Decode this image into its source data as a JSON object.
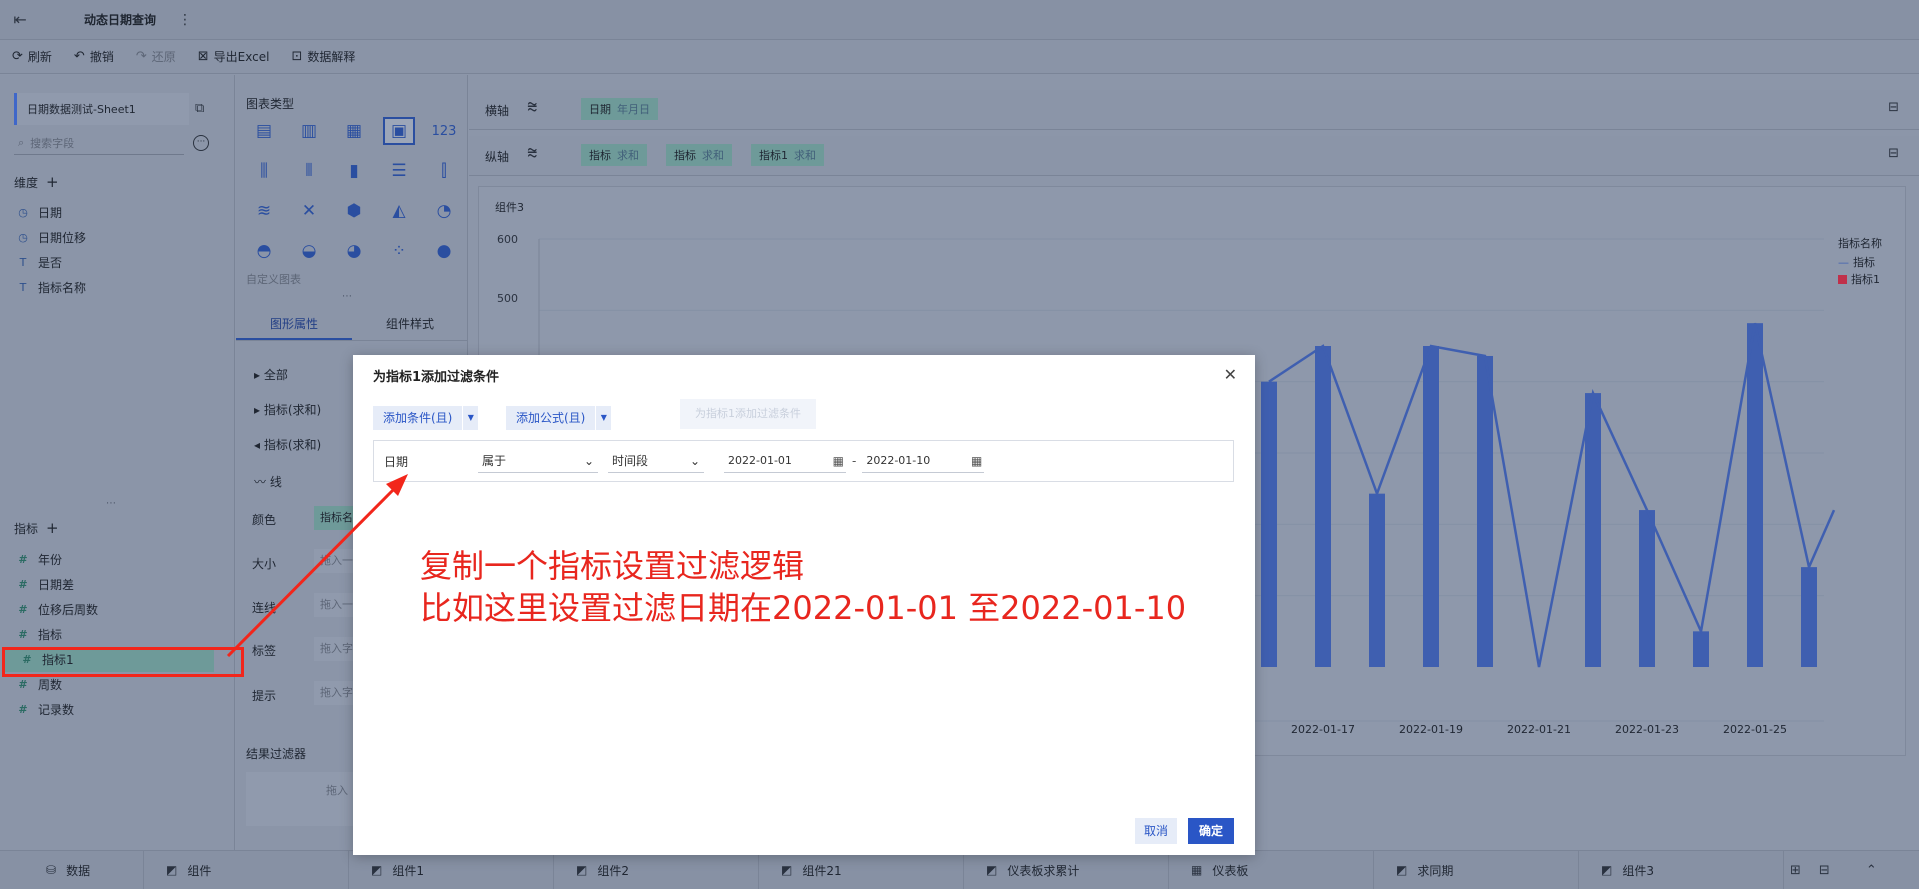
{
  "app": {
    "title": "动态日期查询",
    "back_icon": "back-icon",
    "more_icon": "more-icon"
  },
  "toolbar": {
    "refresh": "刷新",
    "undo": "撤销",
    "redo": "还原",
    "export": "导出Excel",
    "explain": "数据解释"
  },
  "left_panel": {
    "dataset": "日期数据测试-Sheet1",
    "search_placeholder": "搜索字段",
    "dimension_title": "维度",
    "dimensions": [
      {
        "label": "日期",
        "icon": "clock-icon"
      },
      {
        "label": "日期位移",
        "icon": "clock-icon"
      },
      {
        "label": "是否",
        "icon": "text-icon"
      },
      {
        "label": "指标名称",
        "icon": "text-icon"
      }
    ],
    "measure_title": "指标",
    "measures": [
      {
        "label": "年份"
      },
      {
        "label": "日期差"
      },
      {
        "label": "位移后周数"
      },
      {
        "label": "指标"
      },
      {
        "label": "指标1"
      },
      {
        "label": "周数"
      },
      {
        "label": "记录数"
      }
    ]
  },
  "mid_panel": {
    "chart_type_title": "图表类型",
    "custom_chart": "自定义图表",
    "tab_graph": "图形属性",
    "tab_style": "组件样式",
    "props": [
      "全部",
      "指标(求和)",
      "指标(求和)"
    ],
    "line_label": "线",
    "rows": [
      {
        "label": "颜色",
        "value": "指标名"
      },
      {
        "label": "大小",
        "value": "拖入一"
      },
      {
        "label": "连线",
        "value": "拖入一"
      },
      {
        "label": "标签",
        "value": "拖入字"
      },
      {
        "label": "提示",
        "value": "拖入字"
      }
    ],
    "result_filter": "结果过滤器",
    "drop_hint": "拖入"
  },
  "axes": {
    "x_label": "横轴",
    "y_label": "纵轴",
    "x_pills": [
      {
        "name": "日期",
        "sub": "年月日"
      }
    ],
    "y_pills": [
      {
        "name": "指标",
        "sub": "求和"
      },
      {
        "name": "指标",
        "sub": "求和"
      },
      {
        "name": "指标1",
        "sub": "求和"
      }
    ]
  },
  "chart": {
    "component_title": "组件3",
    "legend_title": "指标名称",
    "legend": [
      {
        "name": "指标",
        "color": "#3f5fb0"
      },
      {
        "name": "指标1",
        "color": "#c0304a"
      }
    ],
    "y_ticks": [
      "600",
      "500"
    ],
    "x_ticks": [
      "2022-01-17",
      "2022-01-19",
      "2022-01-21",
      "2022-01-23",
      "2022-01-25"
    ]
  },
  "chart_data": {
    "type": "bar",
    "categories": [
      "2022-01-16",
      "2022-01-17",
      "2022-01-18",
      "2022-01-19",
      "2022-01-20",
      "2022-01-21",
      "2022-01-22",
      "2022-01-23",
      "2022-01-24",
      "2022-01-25",
      "2022-01-26"
    ],
    "series": [
      {
        "name": "指标",
        "values": [
          400,
          450,
          243,
          450,
          436,
          0,
          384,
          220,
          50,
          482,
          140
        ]
      },
      {
        "name": "指标1",
        "values": [
          400,
          450,
          243,
          450,
          436,
          0,
          384,
          220,
          50,
          482,
          140
        ]
      }
    ],
    "y_ticks": [
      500,
      600
    ],
    "x_tick_labels": [
      "2022-01-17",
      "2022-01-19",
      "2022-01-21",
      "2022-01-23",
      "2022-01-25"
    ],
    "ylim": [
      0,
      600
    ]
  },
  "modal": {
    "title": "为指标1添加过滤条件",
    "add_condition": "添加条件(且)",
    "add_formula": "添加公式(且)",
    "ghost": "为指标1添加过滤条件",
    "field": "日期",
    "operator": "属于",
    "range_type": "时间段",
    "date_start": "2022-01-01",
    "date_sep": "-",
    "date_end": "2022-01-10",
    "cancel": "取消",
    "ok": "确定",
    "annotation_line1": "复制一个指标设置过滤逻辑",
    "annotation_line2": "比如这里设置过滤日期在2022-01-01 至2022-01-10"
  },
  "bottom_tabs": [
    {
      "label": "数据",
      "icon": "database-icon"
    },
    {
      "label": "组件",
      "icon": "chart-icon"
    },
    {
      "label": "组件1",
      "icon": "chart-icon"
    },
    {
      "label": "组件2",
      "icon": "chart-icon"
    },
    {
      "label": "组件21",
      "icon": "chart-icon"
    },
    {
      "label": "仪表板求累计",
      "icon": "chart-icon"
    },
    {
      "label": "仪表板",
      "icon": "dashboard-icon"
    },
    {
      "label": "求同期",
      "icon": "chart-icon"
    },
    {
      "label": "组件3",
      "icon": "chart-icon"
    }
  ],
  "colors": {
    "accent": "#2a56c6",
    "annotation": "#e8261e",
    "bar": "#3f5fb0"
  }
}
